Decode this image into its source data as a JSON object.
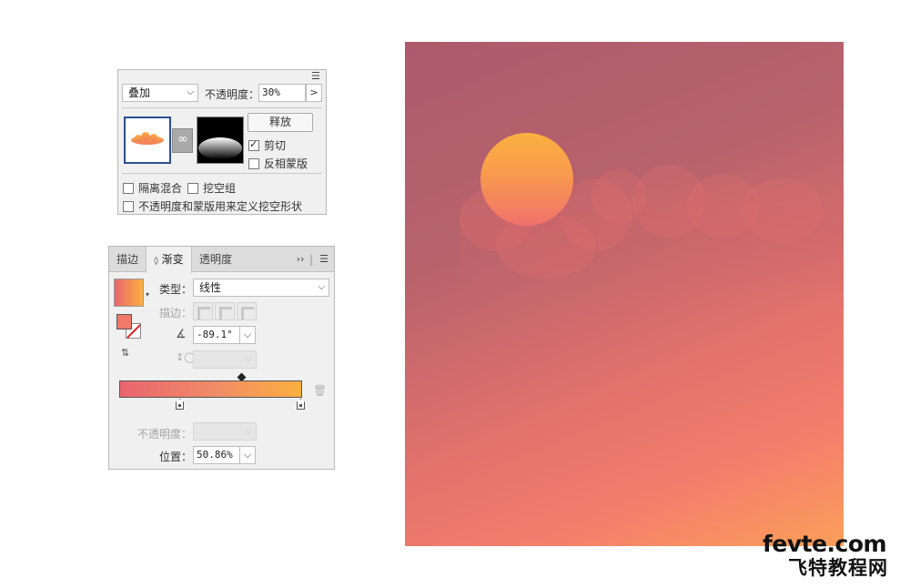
{
  "transparency_panel": {
    "blend_mode": "叠加",
    "opacity_label": "不透明度：",
    "opacity_value": "30%",
    "release_button": "释放",
    "clip_label": "剪切",
    "clip_checked": true,
    "invert_mask_label": "反相蒙版",
    "invert_mask_checked": false,
    "isolate_blending_label": "隔离混合",
    "knockout_group_label": "挖空组",
    "opacity_mask_knockout_label": "不透明度和蒙版用来定义挖空形状"
  },
  "gradient_panel": {
    "tabs": [
      "描边",
      "渐变",
      "透明度"
    ],
    "active_tab": "渐变",
    "type_label": "类型：",
    "type_value": "线性",
    "stroke_label": "描边：",
    "angle_value": "-89.1°",
    "aspect_value": "",
    "opacity_label": "不透明度：",
    "opacity_value": "",
    "location_label": "位置：",
    "location_value": "50.86%",
    "gradient_colors": {
      "start": "#e9656f",
      "end": "#fbb040"
    },
    "selected_stop_location": 50.86
  },
  "artboard": {
    "background_colors": [
      "#ad5a6c",
      "#e0716c",
      "#fb9f5a"
    ],
    "sun_colors": [
      "#fbb040",
      "#f0716c"
    ]
  },
  "watermark": {
    "line1": "fevte.com",
    "line2": "飞特教程网"
  }
}
